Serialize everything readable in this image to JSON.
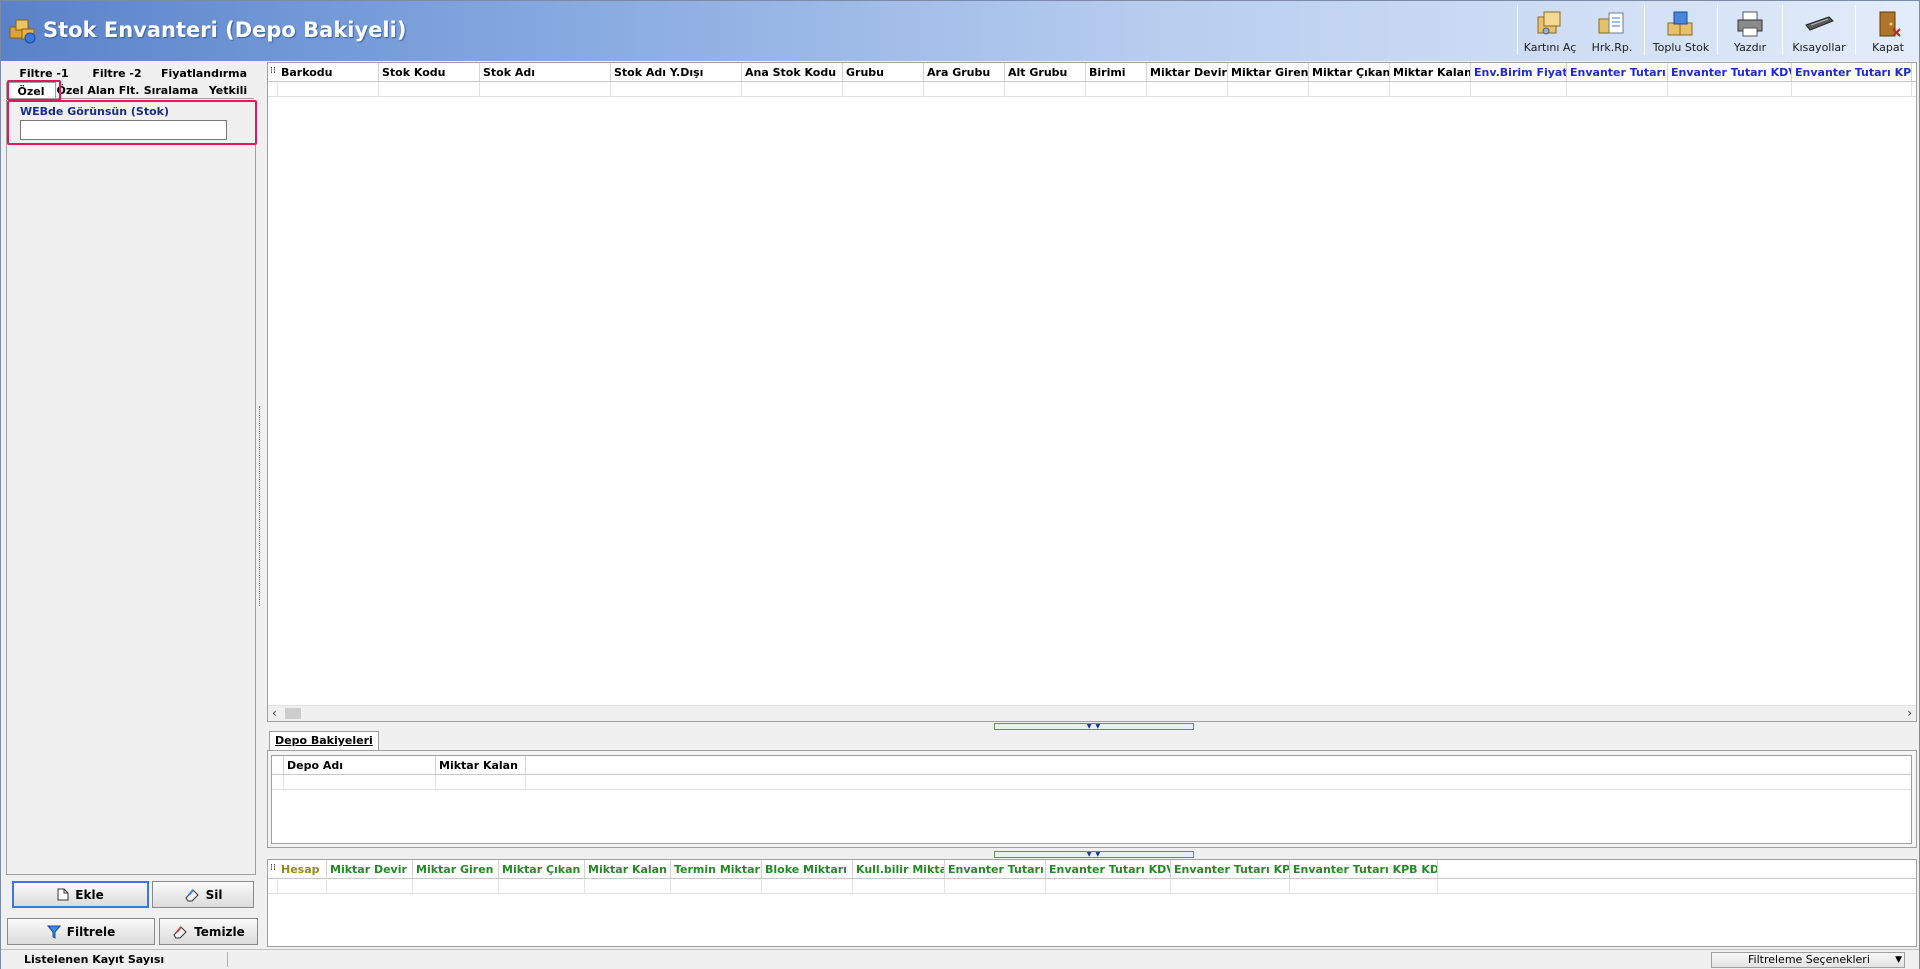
{
  "window": {
    "title": "Stok Envanteri (Depo Bakiyeli)"
  },
  "toolbar": {
    "buttons": [
      {
        "label": "Kartını Aç",
        "icon": "open-card-icon"
      },
      {
        "label": "Hrk.Rp.",
        "icon": "movement-report-icon"
      },
      {
        "label": "Toplu Stok",
        "icon": "bulk-stock-icon"
      },
      {
        "label": "Yazdır",
        "icon": "printer-icon"
      },
      {
        "label": "Kısayollar",
        "icon": "keyboard-icon"
      },
      {
        "label": "Kapat",
        "icon": "exit-door-icon"
      }
    ]
  },
  "left": {
    "tabs_row1": [
      "Filtre -1",
      "Filtre -2",
      "Fiyatlandırma"
    ],
    "tabs_row2": [
      "Özel",
      "Özel Alan Flt.",
      "Sıralama",
      "Yetkili"
    ],
    "active_tab": "Özel",
    "field": {
      "label": "WEBde Görünsün (Stok)",
      "value": ""
    },
    "buttons": {
      "add": "Ekle",
      "delete": "Sil",
      "filter": "Filtrele",
      "clear": "Temizle"
    }
  },
  "main_grid": {
    "columns": [
      {
        "label": "Barkodu",
        "color": "#000000"
      },
      {
        "label": "Stok Kodu",
        "color": "#000000"
      },
      {
        "label": "Stok Adı",
        "color": "#000000"
      },
      {
        "label": "Stok Adı Y.Dışı",
        "color": "#000000"
      },
      {
        "label": "Ana Stok Kodu",
        "color": "#000000"
      },
      {
        "label": "Grubu",
        "color": "#000000"
      },
      {
        "label": "Ara Grubu",
        "color": "#000000"
      },
      {
        "label": "Alt Grubu",
        "color": "#000000"
      },
      {
        "label": "Birimi",
        "color": "#000000"
      },
      {
        "label": "Miktar Devir",
        "color": "#000000"
      },
      {
        "label": "Miktar Giren",
        "color": "#000000"
      },
      {
        "label": "Miktar Çıkan",
        "color": "#000000"
      },
      {
        "label": "Miktar Kalan",
        "color": "#000000"
      },
      {
        "label": "Env.Birim Fiyatı",
        "color": "#1d2bd0"
      },
      {
        "label": "Envanter Tutarı",
        "color": "#1d2bd0"
      },
      {
        "label": "Envanter Tutarı KDVli",
        "color": "#1d2bd0"
      },
      {
        "label": "Envanter Tutarı KPB",
        "color": "#1d2bd0"
      }
    ]
  },
  "depo": {
    "tab_label": "Depo Bakiyeleri",
    "columns": [
      "Depo Adı",
      "Miktar Kalan"
    ]
  },
  "bottom_grid": {
    "columns": [
      {
        "label": "Hesap",
        "color": "#9a8a12"
      },
      {
        "label": "Miktar Devir",
        "color": "#248a24"
      },
      {
        "label": "Miktar Giren",
        "color": "#248a24"
      },
      {
        "label": "Miktar Çıkan",
        "color": "#248a24"
      },
      {
        "label": "Miktar Kalan",
        "color": "#248a24"
      },
      {
        "label": "Termin Miktarı",
        "color": "#248a24"
      },
      {
        "label": "Bloke Miktarı",
        "color": "#248a24"
      },
      {
        "label": "Kull.bilir Miktar",
        "color": "#248a24"
      },
      {
        "label": "Envanter Tutarı",
        "color": "#248a24"
      },
      {
        "label": "Envanter Tutarı KDVli",
        "color": "#248a24"
      },
      {
        "label": "Envanter Tutarı KPB",
        "color": "#248a24"
      },
      {
        "label": "Envanter Tutarı KPB KDVli",
        "color": "#248a24"
      }
    ]
  },
  "status": {
    "record_count_label": "Listelenen Kayıt Sayısı",
    "filter_options_label": "Filtreleme Seçenekleri"
  }
}
